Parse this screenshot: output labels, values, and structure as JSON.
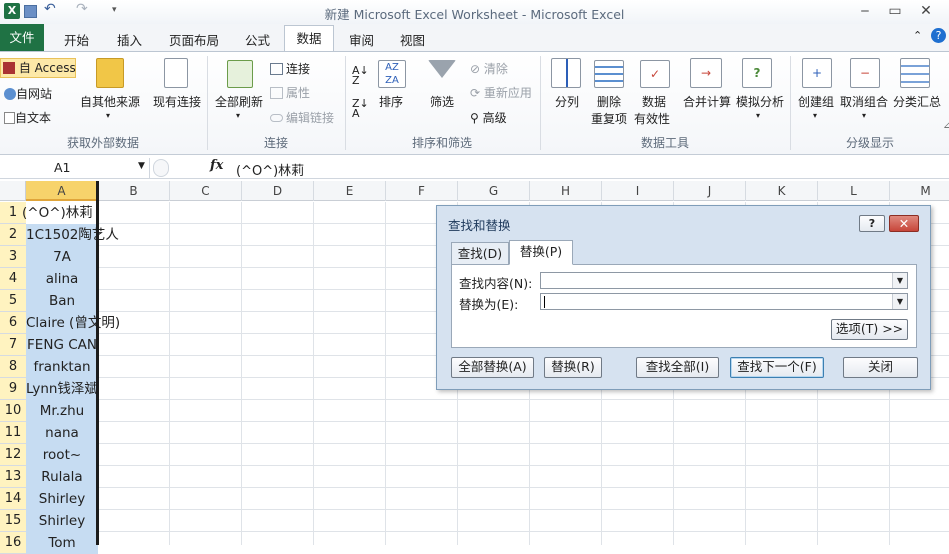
{
  "window": {
    "title": "新建 Microsoft Excel Worksheet  -  Microsoft Excel"
  },
  "tabs": {
    "file": "文件",
    "home": "开始",
    "insert": "插入",
    "layout": "页面布局",
    "formulas": "公式",
    "data": "数据",
    "review": "审阅",
    "view": "视图"
  },
  "ribbon": {
    "get_external": {
      "access": "自 Access",
      "web": "自网站",
      "text": "自文本",
      "other": "自其他来源",
      "existing": "现有连接",
      "label": "获取外部数据"
    },
    "connections": {
      "refresh": "全部刷新",
      "connections": "连接",
      "properties": "属性",
      "edit_links": "编辑链接",
      "label": "连接"
    },
    "sort_filter": {
      "sort": "排序",
      "filter": "筛选",
      "clear": "清除",
      "reapply": "重新应用",
      "advanced": "高级",
      "label": "排序和筛选"
    },
    "data_tools": {
      "split": "分列",
      "remove_dup_1": "删除",
      "remove_dup_2": "重复项",
      "validation_1": "数据",
      "validation_2": "有效性",
      "consolidate": "合并计算",
      "whatif": "模拟分析",
      "label": "数据工具"
    },
    "outline": {
      "group": "创建组",
      "ungroup": "取消组合",
      "subtotal": "分类汇总",
      "label": "分级显示"
    }
  },
  "formula_bar": {
    "name_box": "A1",
    "fx": "fx",
    "content": "(^O^)林莉"
  },
  "columns": [
    "A",
    "B",
    "C",
    "D",
    "E",
    "F",
    "G",
    "H",
    "I",
    "J",
    "K",
    "L",
    "M"
  ],
  "rows": [
    {
      "n": "1",
      "a": "(^O^)林莉"
    },
    {
      "n": "2",
      "a": "1C1502陶艺人"
    },
    {
      "n": "3",
      "a": "7A"
    },
    {
      "n": "4",
      "a": "alina"
    },
    {
      "n": "5",
      "a": "Ban"
    },
    {
      "n": "6",
      "a": "Claire (曾文明)"
    },
    {
      "n": "7",
      "a": "FENG CAN"
    },
    {
      "n": "8",
      "a": "franktan"
    },
    {
      "n": "9",
      "a": "Lynn钱泽斌"
    },
    {
      "n": "10",
      "a": "Mr.zhu"
    },
    {
      "n": "11",
      "a": "nana"
    },
    {
      "n": "12",
      "a": "root~"
    },
    {
      "n": "13",
      "a": "Rulala"
    },
    {
      "n": "14",
      "a": "Shirley"
    },
    {
      "n": "15",
      "a": "Shirley"
    },
    {
      "n": "16",
      "a": "Tom"
    }
  ],
  "dialog": {
    "title": "查找和替换",
    "help": "?",
    "tab_find": "查找(D)",
    "tab_replace": "替换(P)",
    "find_label": "查找内容(N):",
    "replace_label": "替换为(E):",
    "find_value": "",
    "replace_value": "",
    "options": "选项(T) >>",
    "replace_all": "全部替换(A)",
    "replace": "替换(R)",
    "find_all": "查找全部(I)",
    "find_next": "查找下一个(F)",
    "close": "关闭"
  },
  "colors": {
    "excel_green": "#1f7244",
    "selection": "#c6dcf2",
    "header_highlight": "#f7d36b",
    "dialog_close_red": "#c7463a"
  }
}
